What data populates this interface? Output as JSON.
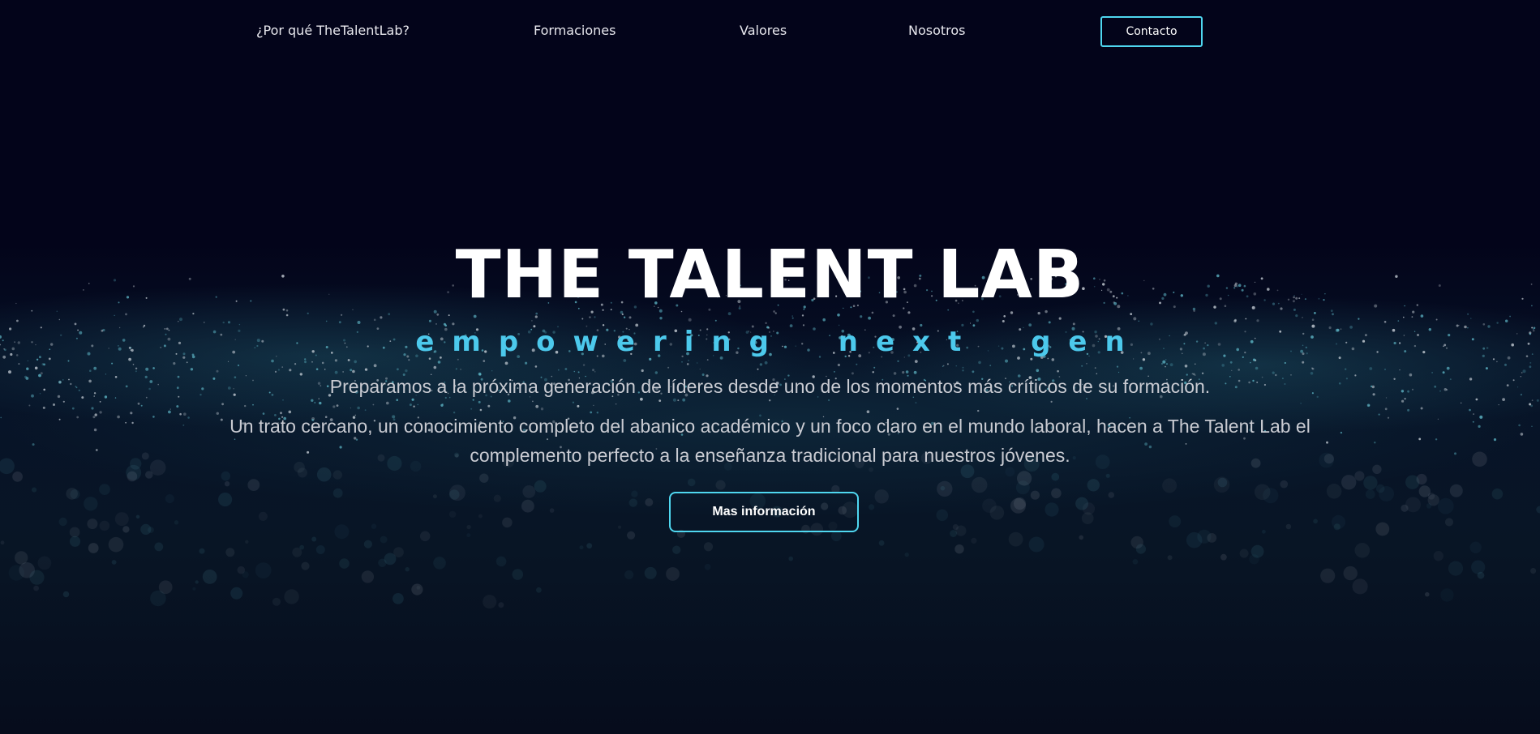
{
  "nav": {
    "items": [
      {
        "label": "¿Por qué TheTalentLab?"
      },
      {
        "label": "Formaciones"
      },
      {
        "label": "Valores"
      },
      {
        "label": "Nosotros"
      }
    ],
    "contact_label": "Contacto"
  },
  "hero": {
    "title": "THE TALENT LAB",
    "tagline": "empowering next gen",
    "paragraph_1": "Preparamos a la próxima generación de líderes desde uno de los momentos más críticos de su formación.",
    "paragraph_2": "Un trato cercano, un conocimiento completo del abanico académico y un foco claro en el mundo laboral, hacen a The Talent Lab el complemento perfecto a la enseñanza tradicional para nuestros jóvenes.",
    "cta_label": "Mas información"
  },
  "colors": {
    "background": "#03041a",
    "accent": "#4fd7f0",
    "tagline": "#4cc9ec"
  }
}
